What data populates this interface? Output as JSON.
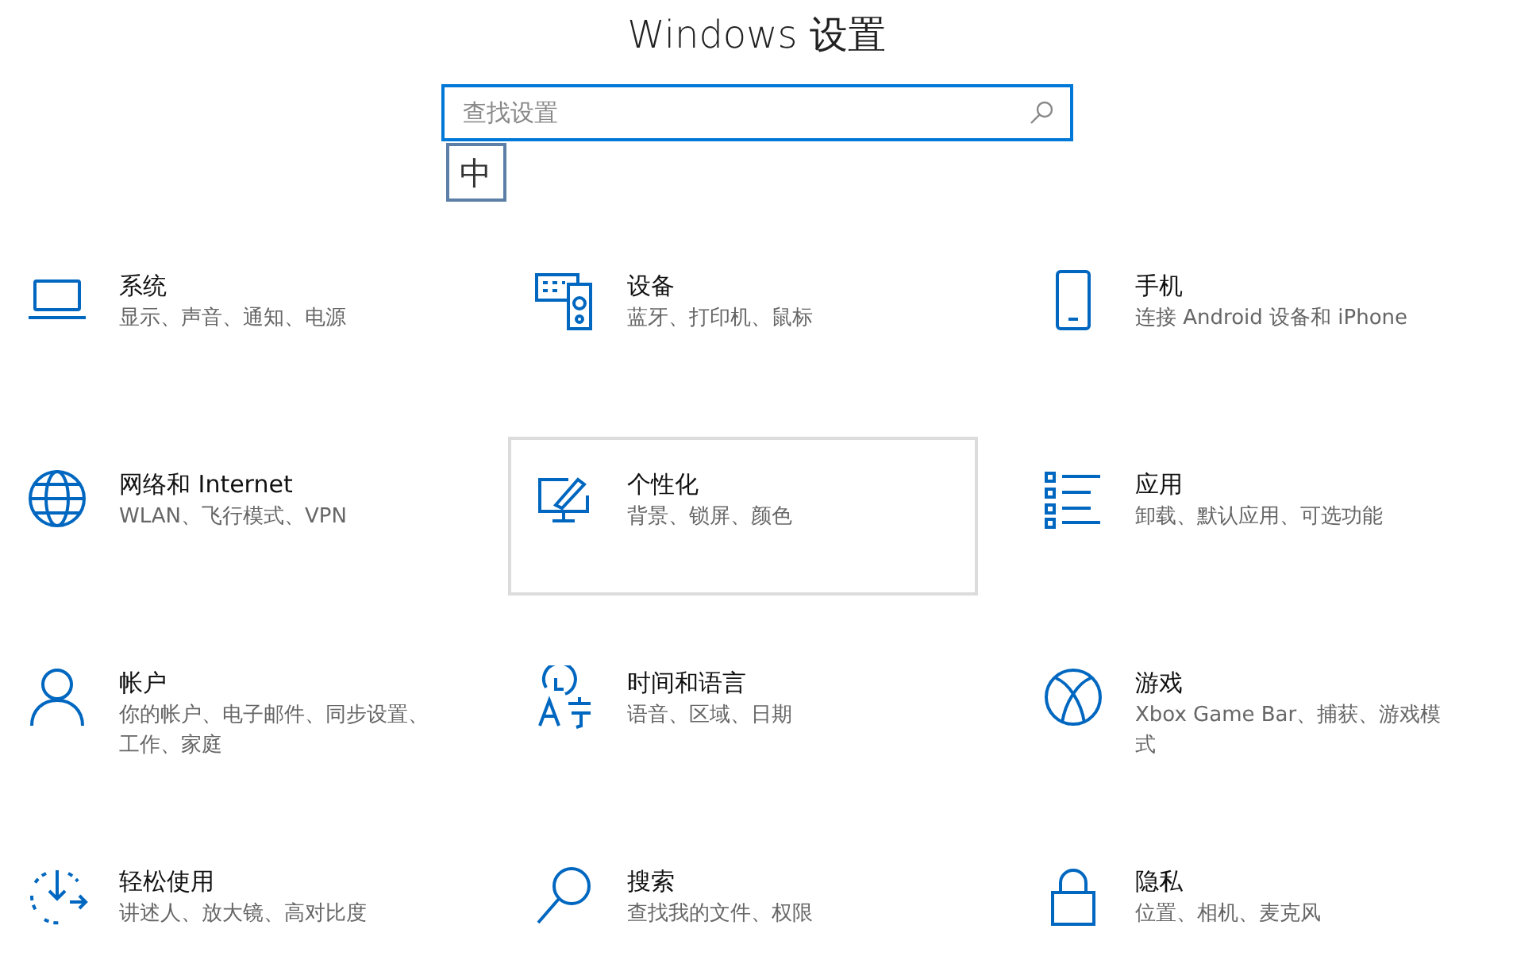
{
  "window": {
    "title": "Windows 设置"
  },
  "search": {
    "placeholder": "查找设置"
  },
  "ime_indicator": "中",
  "categories": [
    {
      "title": "系统",
      "subtitle": "显示、声音、通知、电源",
      "hovered": false
    },
    {
      "title": "设备",
      "subtitle": "蓝牙、打印机、鼠标",
      "hovered": false
    },
    {
      "title": "手机",
      "subtitle": "连接 Android 设备和 iPhone",
      "hovered": false
    },
    {
      "title": "网络和 Internet",
      "subtitle": "WLAN、飞行模式、VPN",
      "hovered": false
    },
    {
      "title": "个性化",
      "subtitle": "背景、锁屏、颜色",
      "hovered": true
    },
    {
      "title": "应用",
      "subtitle": "卸载、默认应用、可选功能",
      "hovered": false
    },
    {
      "title": "帐户",
      "subtitle": "你的帐户、电子邮件、同步设置、工作、家庭",
      "hovered": false
    },
    {
      "title": "时间和语言",
      "subtitle": "语音、区域、日期",
      "hovered": false
    },
    {
      "title": "游戏",
      "subtitle": "Xbox Game Bar、捕获、游戏模式",
      "hovered": false
    },
    {
      "title": "轻松使用",
      "subtitle": "讲述人、放大镜、高对比度",
      "hovered": false
    },
    {
      "title": "搜索",
      "subtitle": "查找我的文件、权限",
      "hovered": false
    },
    {
      "title": "隐私",
      "subtitle": "位置、相机、麦克风",
      "hovered": false
    }
  ]
}
